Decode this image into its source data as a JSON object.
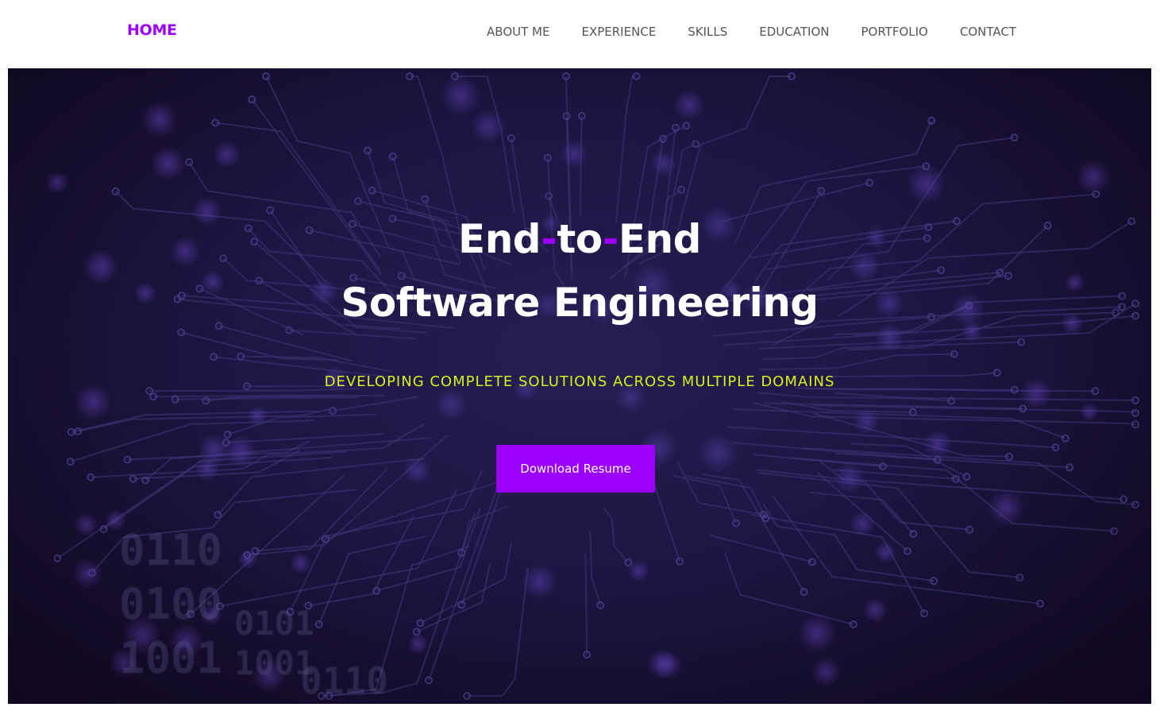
{
  "nav": {
    "brand": "HOME",
    "links": [
      "ABOUT ME",
      "EXPERIENCE",
      "SKILLS",
      "EDUCATION",
      "PORTFOLIO",
      "CONTACT"
    ]
  },
  "hero": {
    "headline_part1": "End",
    "headline_dash1": "-",
    "headline_part2": "to",
    "headline_dash2": "-",
    "headline_part3": "End",
    "headline_line2": "Software Engineering",
    "tagline": "DEVELOPING COMPLETE SOLUTIONS ACROSS MULTIPLE DOMAINS",
    "cta_label": "Download Resume",
    "background_binary": [
      "0110",
      "0100",
      "1001",
      "0101",
      "1001",
      "0110"
    ]
  },
  "colors": {
    "accent": "#9b00ff",
    "tagline": "#d4f21a",
    "nav_text": "#555555",
    "hero_bg": "#1f1645"
  }
}
